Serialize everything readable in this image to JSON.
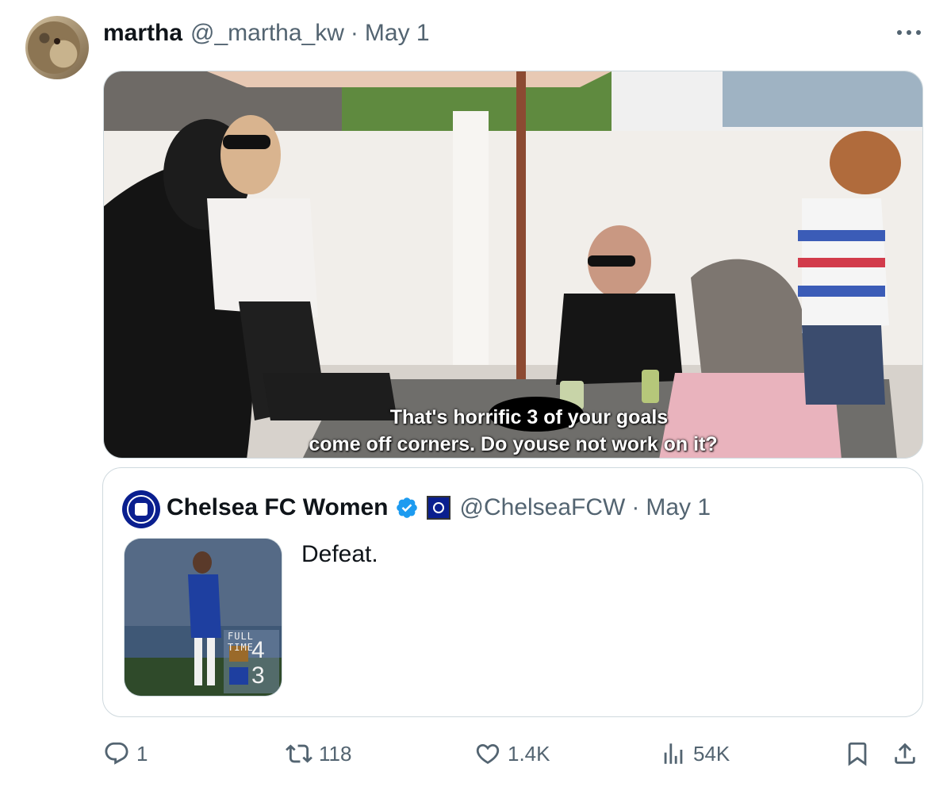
{
  "tweet": {
    "author_name": "martha",
    "author_handle": "@_martha_kw",
    "separator": "·",
    "date": "May 1",
    "media": {
      "caption_line1": "That's horrific 3 of your goals",
      "caption_line2": "come off corners. Do youse not work on it?"
    }
  },
  "quote": {
    "author_name": "Chelsea FC Women",
    "author_handle": "@ChelseaFCW",
    "separator": "·",
    "date": "May 1",
    "text": "Defeat.",
    "thumbnail": {
      "label": "FULL TIME",
      "score_top": "4",
      "score_bottom": "3"
    }
  },
  "actions": {
    "replies": "1",
    "retweets": "118",
    "likes": "1.4K",
    "views": "54K"
  },
  "colors": {
    "text": "#0f1419",
    "secondary": "#536471",
    "border": "#cfd9de",
    "verified": "#1d9bf0",
    "chelsea_blue": "#0a1f8f"
  },
  "icons": [
    "more-icon",
    "verified-icon",
    "reply-icon",
    "retweet-icon",
    "like-icon",
    "views-icon",
    "bookmark-icon",
    "share-icon"
  ]
}
